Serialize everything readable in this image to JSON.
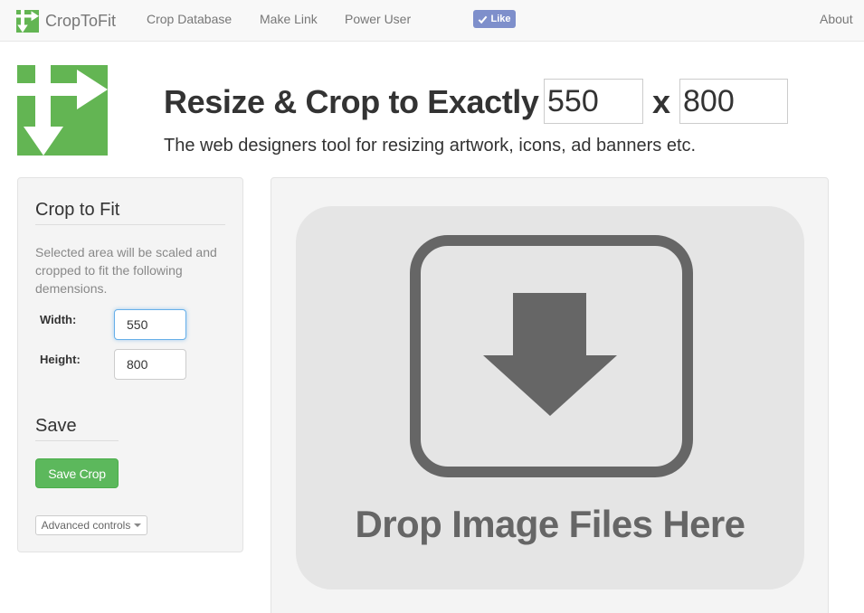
{
  "navbar": {
    "brand": "CropToFit",
    "links": [
      {
        "label": "Crop Database"
      },
      {
        "label": "Make Link"
      },
      {
        "label": "Power User"
      }
    ],
    "like_label": "Like",
    "about_label": "About"
  },
  "header": {
    "headline": "Resize & Crop to Exactly",
    "width_value": "550",
    "times": "x",
    "height_value": "800",
    "tagline": "The web designers tool for resizing artwork, icons, ad banners etc."
  },
  "sidebar": {
    "crop_title": "Crop to Fit",
    "description": "Selected area will be scaled and cropped to fit the following demensions.",
    "width_label": "Width:",
    "width_value": "550",
    "height_label": "Height:",
    "height_value": "800",
    "save_title": "Save",
    "save_button": "Save Crop",
    "advanced_button": "Advanced controls"
  },
  "dropzone": {
    "text": "Drop Image Files Here"
  },
  "colors": {
    "brand_green": "#63b553",
    "save_green": "#5cb85c",
    "like_blue": "#7e8fcb",
    "icon_gray": "#666666"
  }
}
